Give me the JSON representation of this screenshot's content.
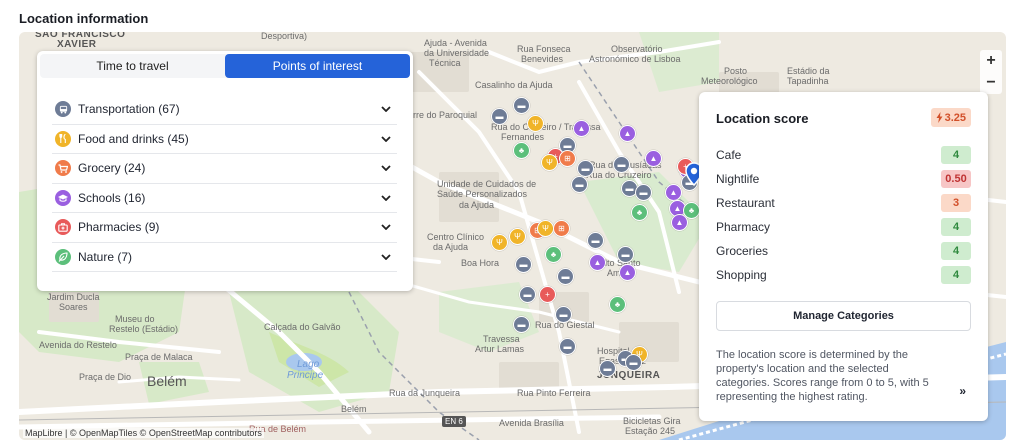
{
  "section_title": "Location information",
  "tabs": [
    {
      "label": "Time to travel",
      "active": false
    },
    {
      "label": "Points of interest",
      "active": true
    }
  ],
  "categories": [
    {
      "label": "Transportation (67)",
      "icon": "bus-icon",
      "color": "#6e7c96"
    },
    {
      "label": "Food and drinks (45)",
      "icon": "utensils-icon",
      "color": "#f0b429"
    },
    {
      "label": "Grocery (24)",
      "icon": "cart-icon",
      "color": "#f07b4a"
    },
    {
      "label": "Schools (16)",
      "icon": "graduation-cap-icon",
      "color": "#9a5fe0"
    },
    {
      "label": "Pharmacies (9)",
      "icon": "medkit-icon",
      "color": "#e85a5a"
    },
    {
      "label": "Nature (7)",
      "icon": "leaf-icon",
      "color": "#5cbf7b"
    }
  ],
  "score_panel": {
    "title": "Location score",
    "overall": "3.25",
    "rows": [
      {
        "label": "Cafe",
        "value": "4",
        "level": "good"
      },
      {
        "label": "Nightlife",
        "value": "0.50",
        "level": "bad"
      },
      {
        "label": "Restaurant",
        "value": "3",
        "level": "mid"
      },
      {
        "label": "Pharmacy",
        "value": "4",
        "level": "good"
      },
      {
        "label": "Groceries",
        "value": "4",
        "level": "good"
      },
      {
        "label": "Shopping",
        "value": "4",
        "level": "good"
      }
    ],
    "manage_label": "Manage Categories",
    "description": "The location score is determined by the property's location and the selected categories. Scores range from 0 to 5, with 5 representing the highest rating.",
    "expand_label": "»"
  },
  "map": {
    "zoom_in": "+",
    "zoom_out": "−",
    "attribution": "MapLibre | © OpenMapTiles © OpenStreetMap contributors",
    "road_shield": "EN 6",
    "labels": [
      "SÃO FRANCISCO",
      "XAVIER",
      "Desportiva)",
      "Ajuda - Avenida",
      "da Universidade",
      "Técnica",
      "Rua Fonseca",
      "Benevides",
      "Observatório",
      "Astronómico de Lisboa",
      "Posto",
      "Meteorológico",
      "Estádio da",
      "Tapadinha",
      "Casalinho da Ajuda",
      "rre do Paroquial",
      "Rua do Cruzeiro / Travessa",
      "Fernandes",
      "Rua dos Lusíadas",
      "/ Rua do Cruzeiro",
      "Unidade de Cuidados de",
      "Saúde Personalizados",
      "da Ajuda",
      "Centro Clínico",
      "da Ajuda",
      "Boa Hora",
      "Alto Santo",
      "Amaro",
      "Jardim Ducla",
      "Soares",
      "Museu do",
      "Restelo (Estádio)",
      "Calçada do Galvão",
      "Avenida do Restelo",
      "Praça de Malaca",
      "Praça de Dio",
      "Belém",
      "Lago",
      "Principe",
      "Rua do Giestal",
      "Travessa",
      "Artur Lamas",
      "Hospital da",
      "Egas Moniz",
      "JUNQUEIRA",
      "Rua da Junqueira",
      "Rua Pinto Ferreira",
      "Avenida Brasília",
      "Belém",
      "Rua de Belém",
      "Bicicletas Gira",
      "Estação 245"
    ]
  }
}
